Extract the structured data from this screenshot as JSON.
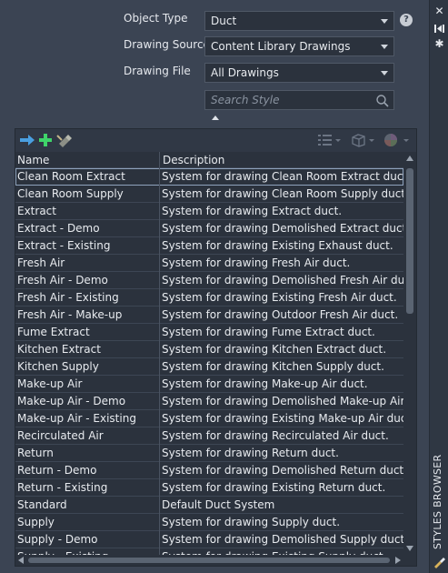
{
  "form": {
    "object_type_label": "Object Type",
    "object_type_value": "Duct",
    "drawing_source_label": "Drawing Source",
    "drawing_source_value": "Content Library Drawings",
    "drawing_file_label": "Drawing File",
    "drawing_file_value": "All Drawings",
    "search_placeholder": "Search Style",
    "help_glyph": "?"
  },
  "toolbar": {
    "icons": [
      "import-arrow-icon",
      "add-icon",
      "purge-icon",
      "list-view-icon",
      "preview-cube-icon",
      "color-wheel-icon"
    ]
  },
  "grid": {
    "col_name": "Name",
    "col_description": "Description",
    "rows": [
      {
        "name": "Clean Room Extract",
        "description": "System for drawing Clean Room Extract duct."
      },
      {
        "name": "Clean Room Supply",
        "description": "System for drawing Clean Room Supply duct."
      },
      {
        "name": "Extract",
        "description": "System for drawing Extract duct."
      },
      {
        "name": "Extract - Demo",
        "description": "System for drawing Demolished Extract duct."
      },
      {
        "name": "Extract - Existing",
        "description": "System for drawing Existing Exhaust duct."
      },
      {
        "name": "Fresh Air",
        "description": "System for drawing Fresh Air duct."
      },
      {
        "name": "Fresh Air - Demo",
        "description": "System for drawing Demolished Fresh Air duct."
      },
      {
        "name": "Fresh Air - Existing",
        "description": "System for drawing Existing Fresh Air duct."
      },
      {
        "name": "Fresh Air - Make-up",
        "description": "System for drawing Outdoor Fresh Air duct."
      },
      {
        "name": "Fume Extract",
        "description": "System for drawing Fume Extract duct."
      },
      {
        "name": "Kitchen Extract",
        "description": "System for drawing Kitchen Extract duct."
      },
      {
        "name": "Kitchen Supply",
        "description": "System for drawing Kitchen Supply duct."
      },
      {
        "name": "Make-up Air",
        "description": "System for drawing Make-up Air duct."
      },
      {
        "name": "Make-up Air - Demo",
        "description": "System for drawing Demolished Make-up Air duct."
      },
      {
        "name": "Make-up Air - Existing",
        "description": "System for drawing Existing Make-up Air duct."
      },
      {
        "name": "Recirculated Air",
        "description": "System for drawing Recirculated Air duct."
      },
      {
        "name": "Return",
        "description": "System for drawing Return duct."
      },
      {
        "name": "Return - Demo",
        "description": "System for drawing Demolished Return duct."
      },
      {
        "name": "Return - Existing",
        "description": "System for drawing Existing Return duct."
      },
      {
        "name": "Standard",
        "description": "Default Duct System"
      },
      {
        "name": "Supply",
        "description": "System for drawing Supply duct."
      },
      {
        "name": "Supply - Demo",
        "description": "System for drawing Demolished Supply duct."
      },
      {
        "name": "Supply - Existing",
        "description": "System for drawing Existing Supply duct."
      }
    ]
  },
  "palette": {
    "title": "STYLES BROWSER"
  },
  "colors": {
    "panel_bg": "#3b4453",
    "field_bg": "#2b323d",
    "add_green": "#3fd46a",
    "arrow_blue": "#4a9fe0"
  }
}
